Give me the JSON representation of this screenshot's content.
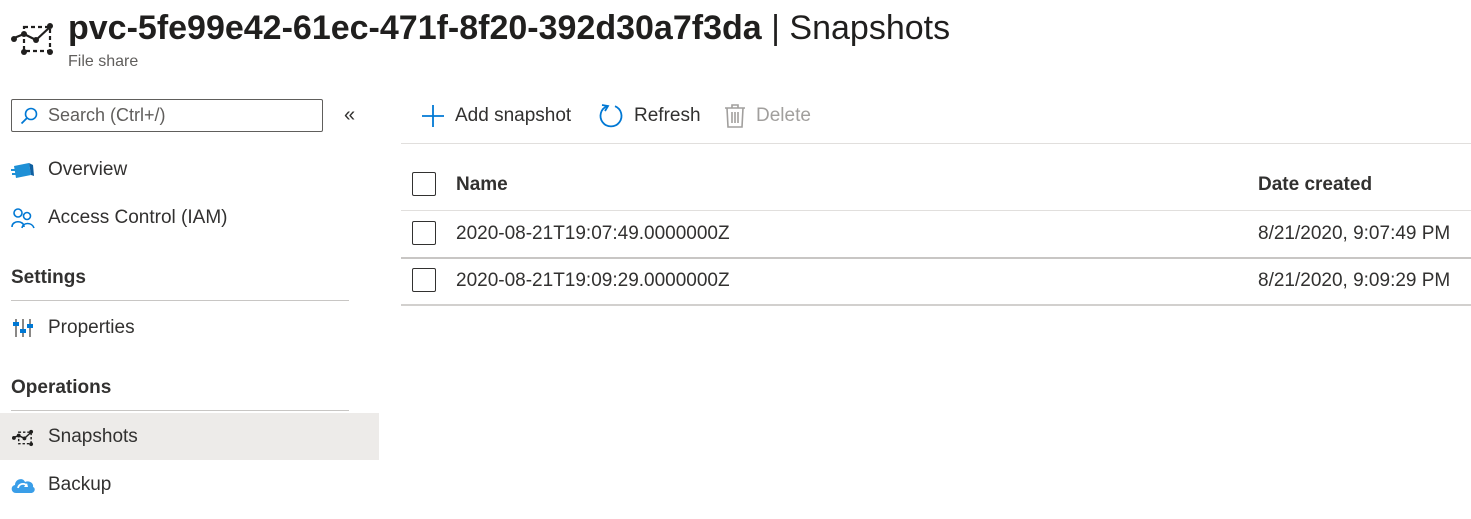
{
  "header": {
    "resource_name": "pvc-5fe99e42-61ec-471f-8f20-392d30a7f3da",
    "separator": "|",
    "page": "Snapshots",
    "subtitle": "File share",
    "icon": "snapshot-icon"
  },
  "sidebar": {
    "search_placeholder": "Search (Ctrl+/)",
    "collapse_glyph": "«",
    "items_top": [
      {
        "label": "Overview",
        "icon": "overview-icon"
      },
      {
        "label": "Access Control (IAM)",
        "icon": "iam-icon"
      }
    ],
    "sections": [
      {
        "title": "Settings",
        "items": [
          {
            "label": "Properties",
            "icon": "properties-icon"
          }
        ]
      },
      {
        "title": "Operations",
        "items": [
          {
            "label": "Snapshots",
            "icon": "snapshot-icon",
            "active": true
          },
          {
            "label": "Backup",
            "icon": "backup-icon"
          }
        ]
      }
    ]
  },
  "toolbar": {
    "add_label": "Add snapshot",
    "refresh_label": "Refresh",
    "delete_label": "Delete"
  },
  "table": {
    "columns": [
      "Name",
      "Date created"
    ],
    "rows": [
      {
        "name": "2020-08-21T19:07:49.0000000Z",
        "date": "8/21/2020, 9:07:49 PM"
      },
      {
        "name": "2020-08-21T19:09:29.0000000Z",
        "date": "8/21/2020, 9:09:29 PM"
      }
    ]
  },
  "colors": {
    "accent": "#0078d4",
    "active_bg": "#edebe9",
    "disabled": "#a19f9d"
  }
}
